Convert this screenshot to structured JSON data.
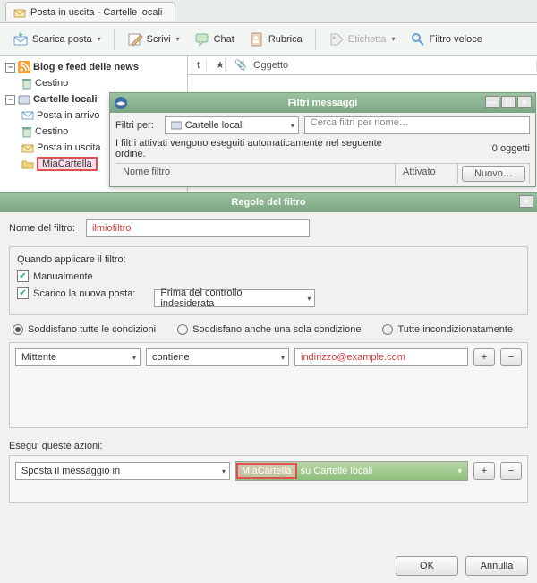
{
  "app_tab": {
    "title": "Posta in uscita - Cartelle locali"
  },
  "toolbar": {
    "get_mail": "Scarica posta",
    "write": "Scrivi",
    "chat": "Chat",
    "address_book": "Rubrica",
    "tag": "Etichetta",
    "quick_filter": "Filtro veloce"
  },
  "tree": {
    "account1": "Blog e feed delle news",
    "trash1": "Cestino",
    "account2": "Cartelle locali",
    "inbox": "Posta in arrivo",
    "trash2": "Cestino",
    "outbox": "Posta in uscita",
    "my_folder": "MiaCartella"
  },
  "cols": {
    "subject": "Oggetto"
  },
  "filters_window": {
    "title": "Filtri messaggi",
    "filters_for": "Filtri per:",
    "account": "Cartelle locali",
    "search_placeholder": "Cerca filtri per nome…",
    "hint": "I filtri attivati vengono eseguiti automaticamente nel seguente ordine.",
    "objects": "0 oggetti",
    "col_name": "Nome filtro",
    "col_enabled": "Attivato",
    "new_btn": "Nuovo…"
  },
  "rules_dialog": {
    "title": "Regole del filtro",
    "name_label": "Nome del filtro:",
    "name_value": "ilmiofiltro",
    "when_label": "Quando applicare il filtro:",
    "chk_manual": "Manualmente",
    "chk_download": "Scarico la nuova posta:",
    "download_when": "Prima del controllo indesiderata",
    "radio_all": "Soddisfano tutte le condizioni",
    "radio_any": "Soddisfano anche una sola condizione",
    "radio_always": "Tutte incondizionatamente",
    "cond_field": "Mittente",
    "cond_op": "contiene",
    "cond_value": "indirizzo@example.com",
    "actions_label": "Esegui queste azioni:",
    "action_type": "Sposta il messaggio in",
    "action_folder_tag": "MiaCartella",
    "action_folder_rest": "su Cartelle locali",
    "ok": "OK",
    "cancel": "Annulla"
  }
}
